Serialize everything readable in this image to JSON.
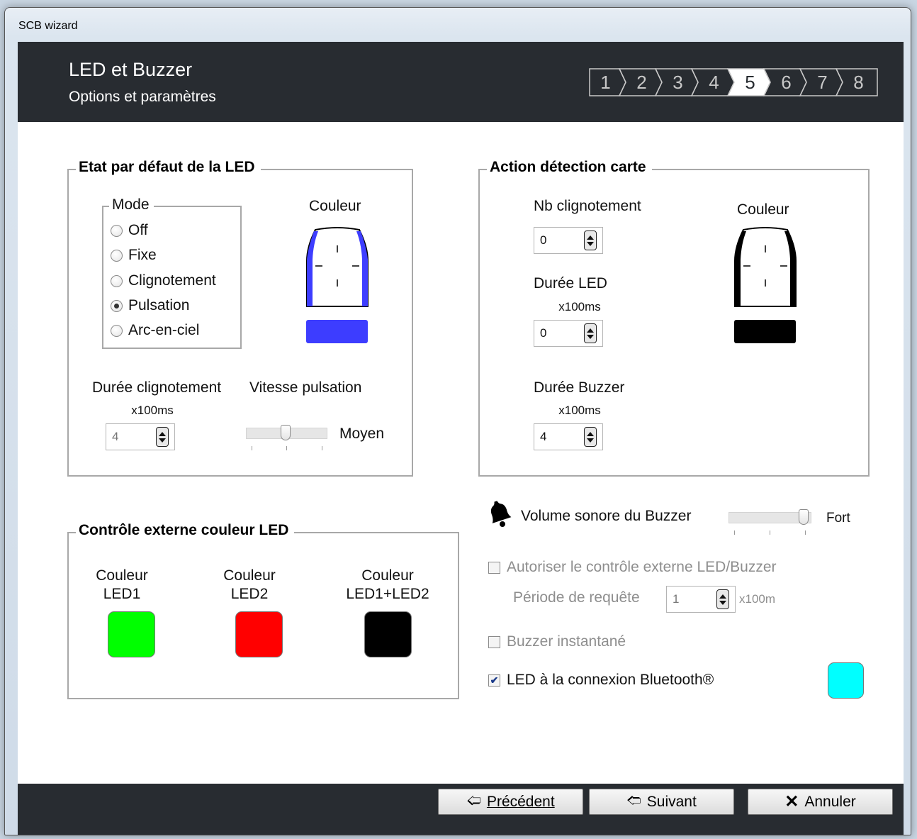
{
  "window": {
    "title": "SCB wizard"
  },
  "header": {
    "title": "LED et Buzzer",
    "subtitle": "Options et paramètres",
    "steps": [
      "1",
      "2",
      "3",
      "4",
      "5",
      "6",
      "7",
      "8"
    ],
    "active_step": 5
  },
  "led_default": {
    "group_label": "Etat par défaut de la LED",
    "mode_label": "Mode",
    "modes": [
      "Off",
      "Fixe",
      "Clignotement",
      "Pulsation",
      "Arc-en-ciel"
    ],
    "selected_mode": "Pulsation",
    "couleur_label": "Couleur",
    "color": "#3d3dff",
    "duree_clign_label": "Durée clignotement",
    "duree_clign_unit": "x100ms",
    "duree_clign_value": "4",
    "vitesse_label": "Vitesse pulsation",
    "vitesse_value_label": "Moyen",
    "vitesse_level": 0.5
  },
  "action_detection": {
    "group_label": "Action détection carte",
    "nb_clign_label": "Nb clignotement",
    "nb_clign_value": "0",
    "duree_led_label": "Durée LED",
    "duree_led_unit": "x100ms",
    "duree_led_value": "0",
    "duree_buzzer_label": "Durée Buzzer",
    "duree_buzzer_unit": "x100ms",
    "duree_buzzer_value": "4",
    "couleur_label": "Couleur",
    "color": "#000000"
  },
  "external_control": {
    "group_label": "Contrôle externe couleur LED",
    "items": [
      {
        "line1": "Couleur",
        "line2": "LED1",
        "color": "#00ff00"
      },
      {
        "line1": "Couleur",
        "line2": "LED2",
        "color": "#ff0000"
      },
      {
        "line1": "Couleur",
        "line2": "LED1+LED2",
        "color": "#000000"
      }
    ]
  },
  "buzzer": {
    "volume_label": "Volume sonore du Buzzer",
    "volume_value_label": "Fort",
    "volume_level": 1.0,
    "autoriser_label": "Autoriser le contrôle externe LED/Buzzer",
    "autoriser_checked": false,
    "periode_label": "Période de requête",
    "periode_value": "1",
    "periode_unit": "x100m",
    "instantane_label": "Buzzer instantané",
    "instantane_checked": false,
    "bluetooth_label": "LED à la connexion Bluetooth®",
    "bluetooth_checked": true,
    "bluetooth_color": "#00ffff"
  },
  "footer": {
    "prev_label": "Précédent",
    "next_label": "Suivant",
    "cancel_label": "Annuler"
  }
}
